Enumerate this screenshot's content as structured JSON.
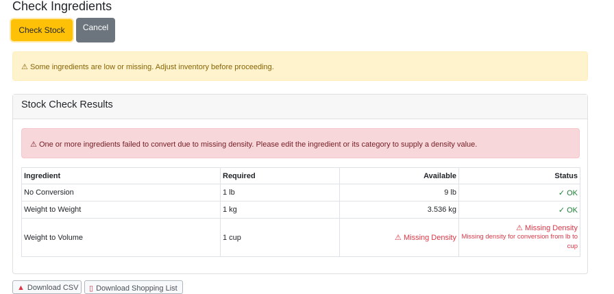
{
  "page": {
    "title": "Check Ingredients"
  },
  "actions": {
    "check_stock": "Check Stock",
    "cancel": "Cancel"
  },
  "warning_alert": {
    "icon": "⚠",
    "text": "Some ingredients are low or missing. Adjust inventory before proceeding."
  },
  "results_card": {
    "title": "Stock Check Results",
    "danger_alert": {
      "icon": "⚠",
      "text": "One or more ingredients failed to convert due to missing density. Please edit the ingredient or its category to supply a density value."
    },
    "table": {
      "headers": [
        "Ingredient",
        "Required",
        "Available",
        "Status"
      ],
      "rows": [
        {
          "ingredient": "No Conversion",
          "required": "1 lb",
          "available": "9 lb",
          "status": "✓ OK"
        },
        {
          "ingredient": "Weight to Weight",
          "required": "1 kg",
          "available": "3.536 kg",
          "status": "✓ OK"
        },
        {
          "ingredient": "Weight to Volume",
          "required": "1 cup",
          "available": "⚠ Missing Density",
          "status": "⚠ Missing Density",
          "status_detail": "Missing density for conversion from lb to cup"
        }
      ]
    }
  },
  "footer_buttons": {
    "download_csv": "Download CSV",
    "download_shopping_list": "Download Shopping List"
  },
  "colors": {
    "warning": "#ffc107",
    "secondary": "#6c757d",
    "success": "#1e7e34",
    "danger": "#dc3545"
  }
}
